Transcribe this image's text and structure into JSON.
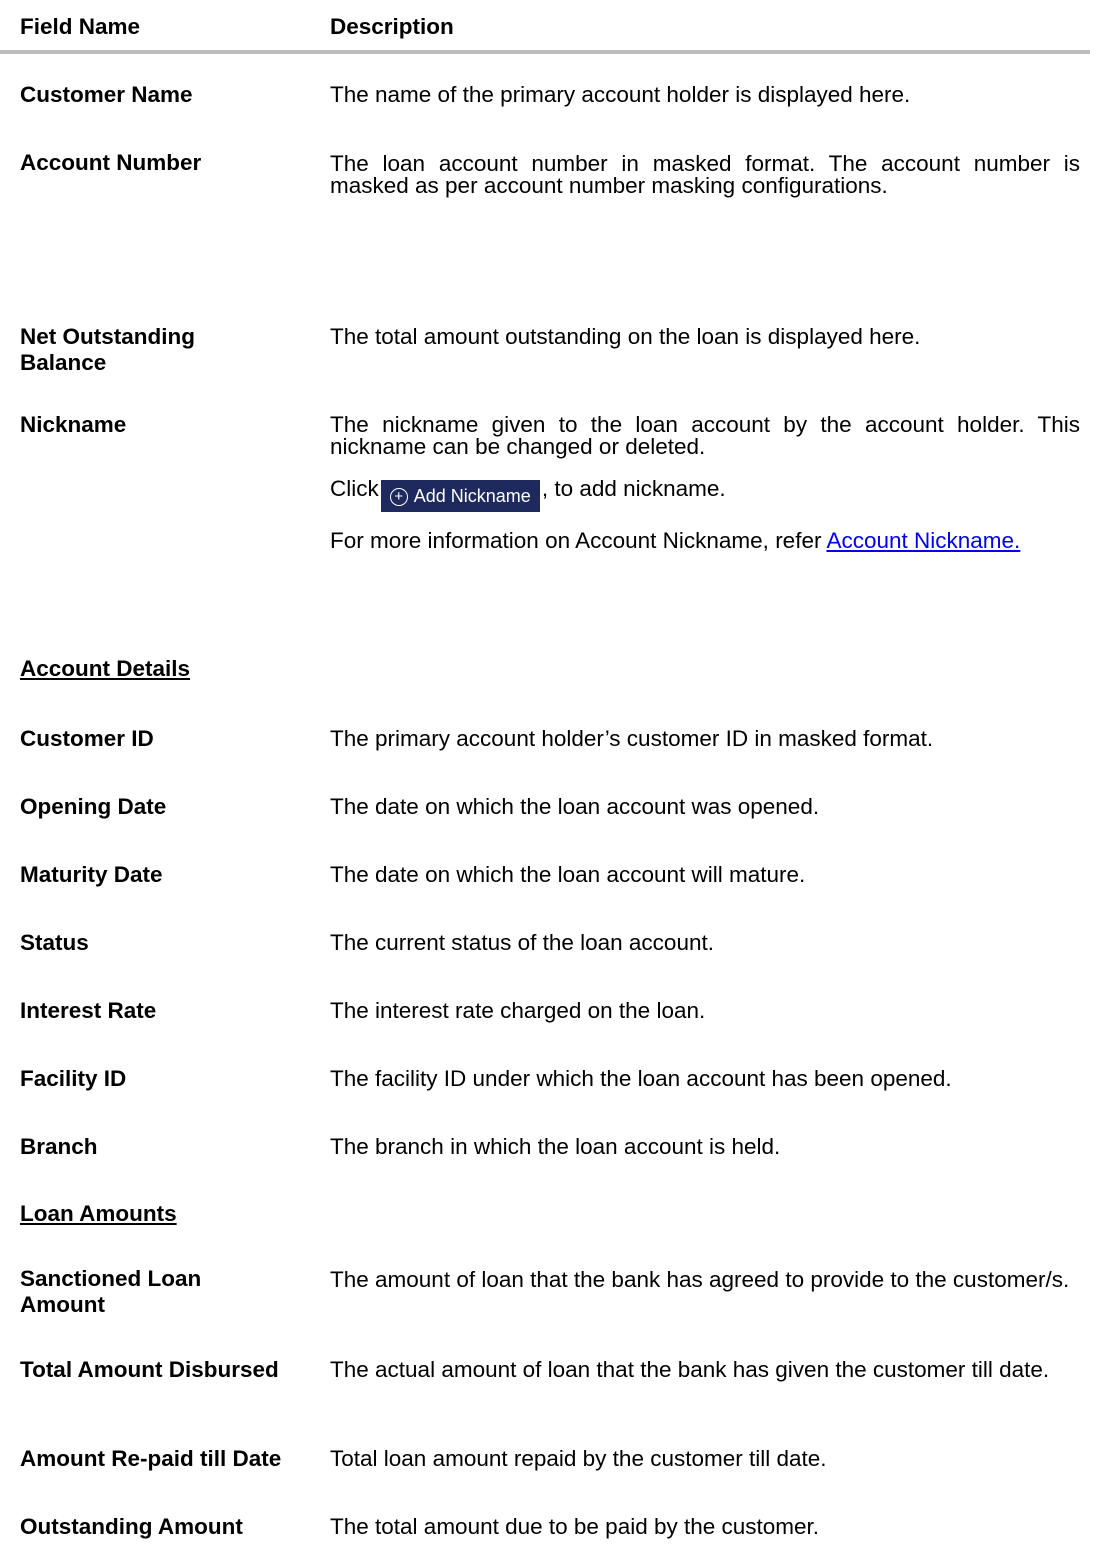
{
  "header": {
    "field_name": "Field Name",
    "description": "Description"
  },
  "rows": [
    {
      "name": "Customer Name",
      "desc": "The name of the primary account holder is displayed here."
    },
    {
      "name": "Account Number",
      "desc": "The loan account number in masked format. The account number is masked as per account number masking configurations."
    },
    {
      "name": "Net Outstanding Balance",
      "desc": "The total amount outstanding on the loan is displayed here."
    },
    {
      "name": "Nickname",
      "desc": "The nickname given to the loan account by the account holder. This nickname can be changed or deleted.",
      "click_prefix": "Click",
      "button_label": "Add Nickname",
      "click_suffix": ", to add nickname.",
      "more_info": "For more information on Account Nickname, refer ",
      "link_text": "Account Nickname."
    }
  ],
  "section_account": "Account Details",
  "account_rows": [
    {
      "name": "Customer ID",
      "desc": "The primary account holder’s customer ID in masked format."
    },
    {
      "name": "Opening Date",
      "desc": "The date on which the loan account was opened."
    },
    {
      "name": "Maturity Date",
      "desc": "The date on which the loan account will mature."
    },
    {
      "name": "Status",
      "desc": "The current status of the loan account."
    },
    {
      "name": "Interest Rate",
      "desc": "The interest rate charged on the loan."
    },
    {
      "name": "Facility ID",
      "desc": "The facility ID under which the loan account has been opened."
    },
    {
      "name": "Branch",
      "desc": "The branch in which the loan account is held."
    }
  ],
  "section_loan": "Loan Amounts",
  "loan_rows": [
    {
      "name": "Sanctioned Loan Amount",
      "desc": "The amount of loan that the bank has agreed to provide to the customer/s."
    },
    {
      "name": "Total Amount Disbursed",
      "desc": "The actual amount of loan that the bank has given the customer till date."
    },
    {
      "name": "Amount Re-paid till Date",
      "desc": "Total loan amount repaid by the customer till date."
    },
    {
      "name": "Outstanding Amount",
      "desc": "The total amount due to be paid by the customer."
    }
  ]
}
